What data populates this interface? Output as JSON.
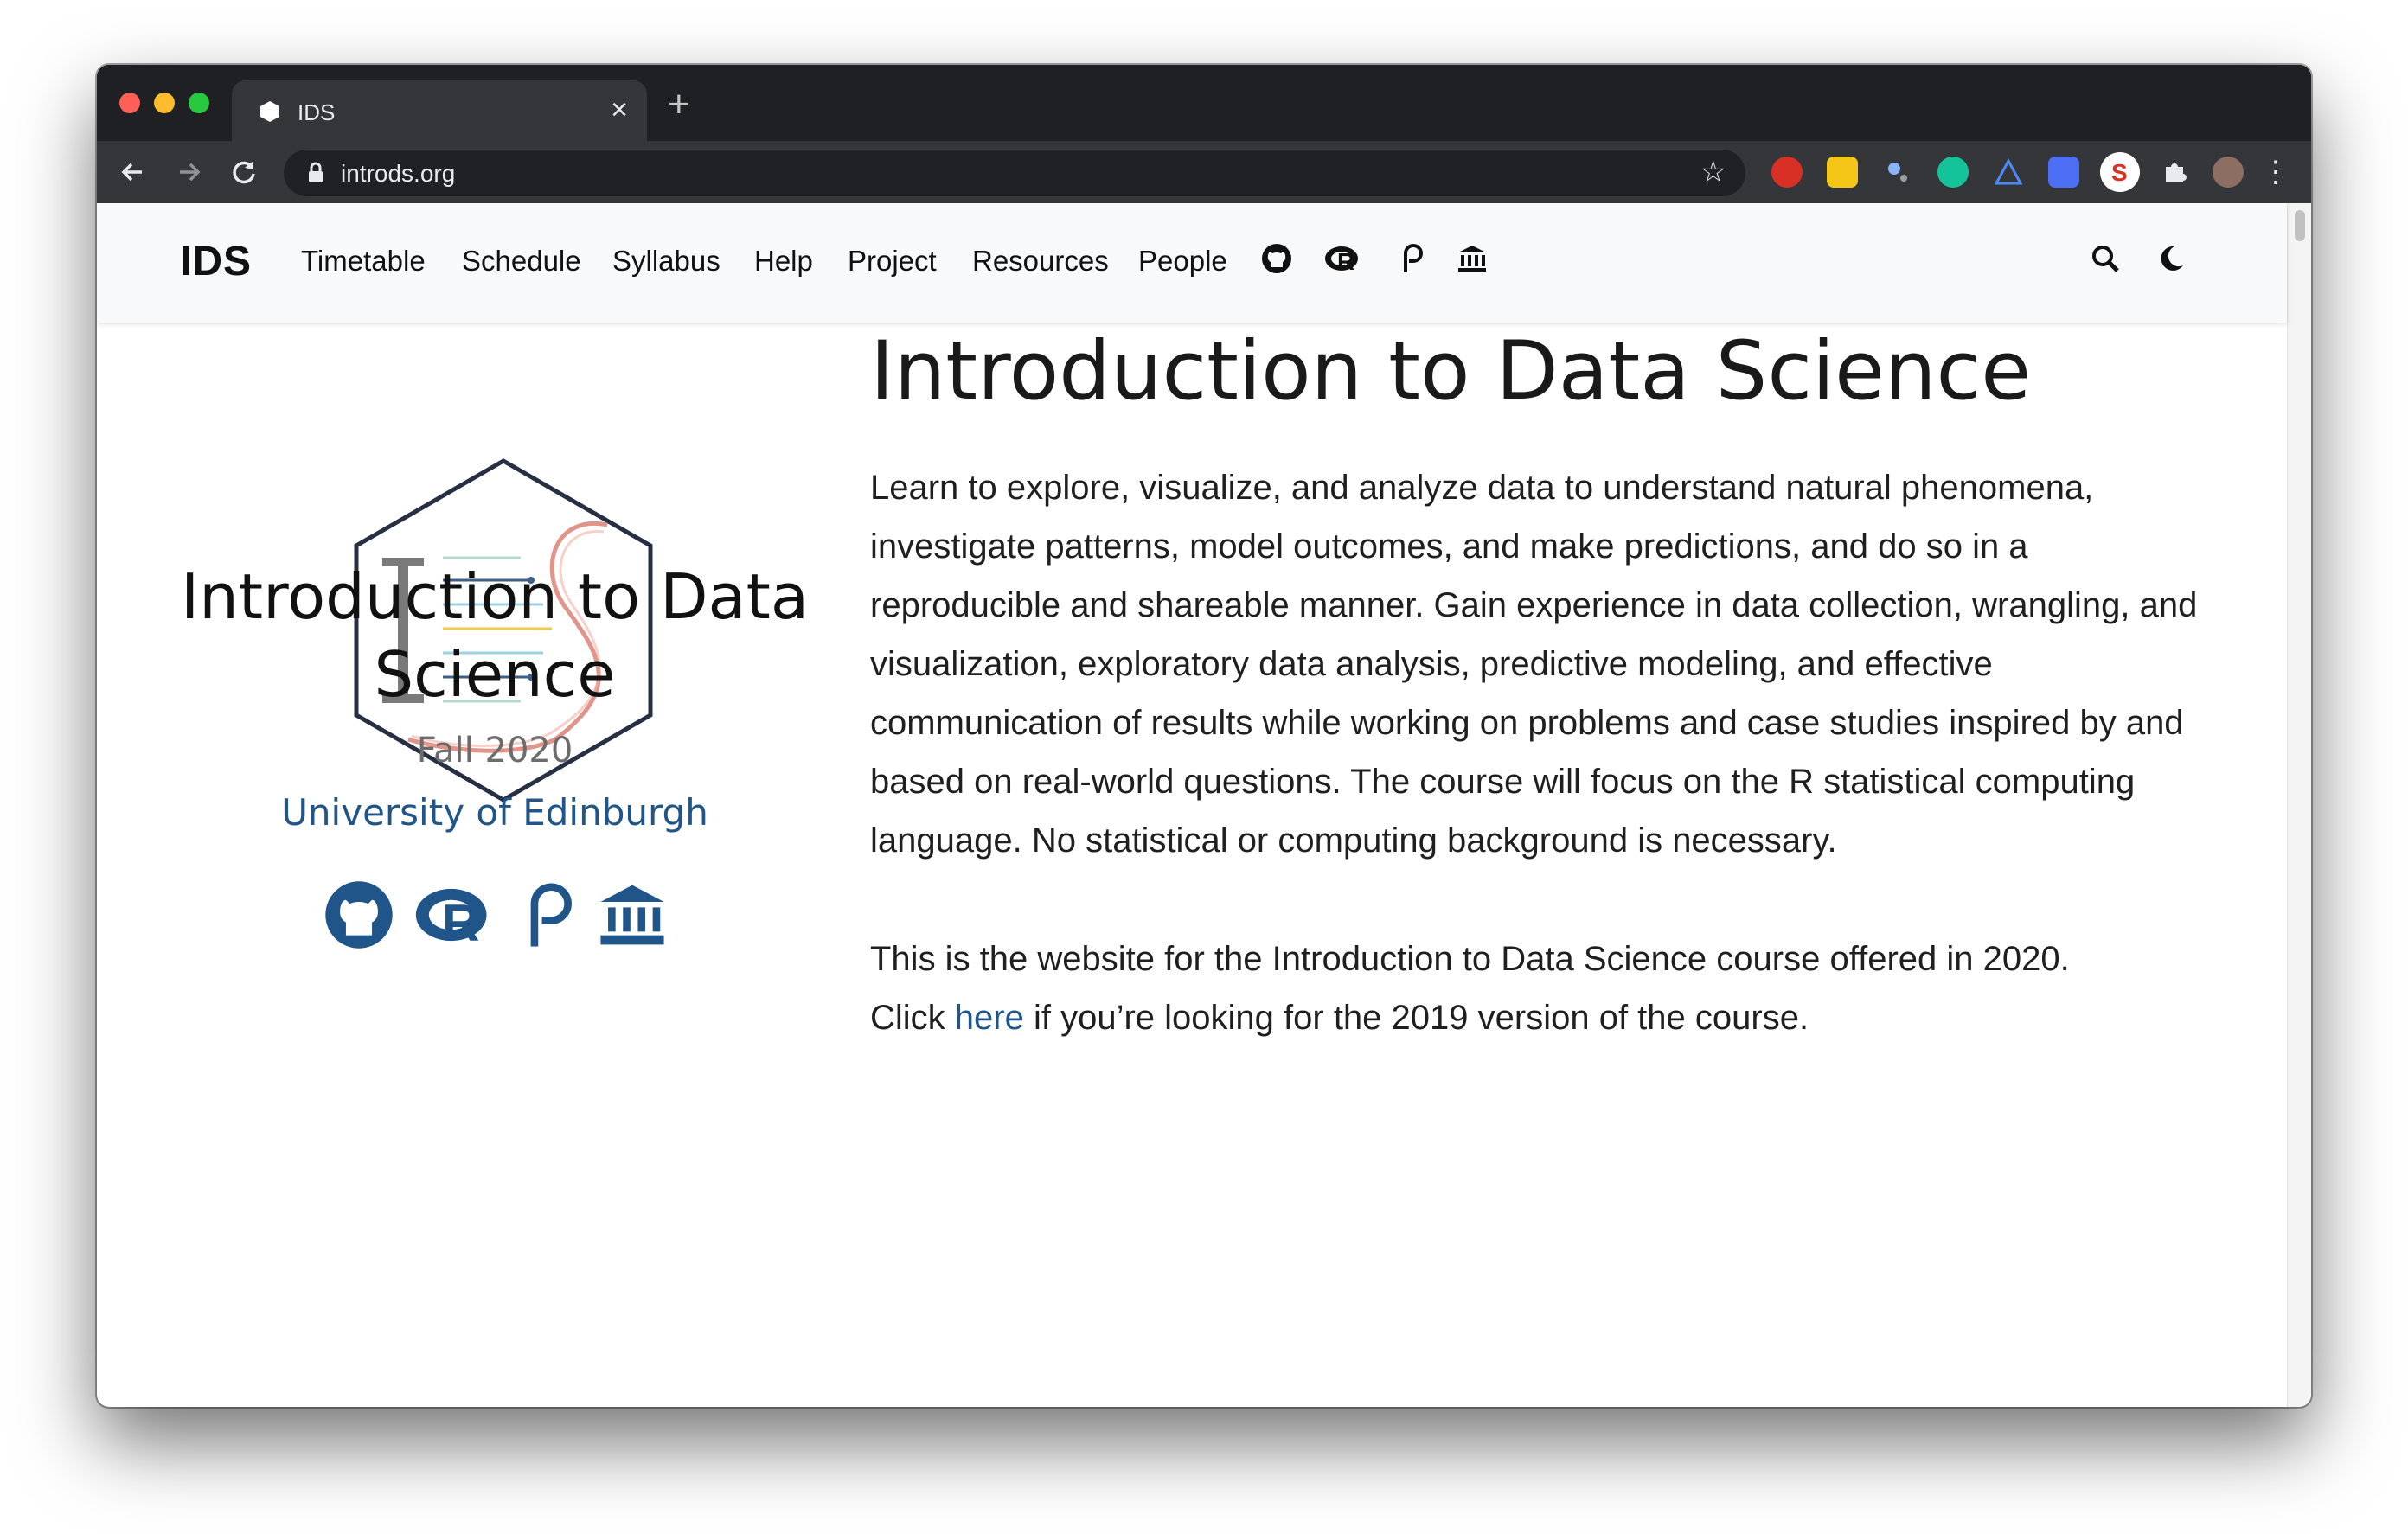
{
  "browser": {
    "tab_title": "IDS",
    "url": "introds.org",
    "new_tab_symbol": "+",
    "close_symbol": "×",
    "extensions": [
      "stop-hand-icon",
      "note-icon",
      "satellite-icon",
      "grammarly-icon",
      "triangle-icon",
      "document-icon",
      "s-extension-icon",
      "puzzle-icon",
      "profile-avatar"
    ]
  },
  "site_nav": {
    "brand": "IDS",
    "links": [
      "Timetable",
      "Schedule",
      "Syllabus",
      "Help",
      "Project",
      "Resources",
      "People"
    ],
    "icons": [
      "github-icon",
      "rstudio-cloud-icon",
      "piazza-icon",
      "university-icon"
    ],
    "right_icons": [
      "search-icon",
      "moon-icon"
    ]
  },
  "sidebar": {
    "title": "Introduction to Data Science",
    "term": "Fall 2020",
    "institution": "University of Edinburgh",
    "icons": [
      "github-icon",
      "rstudio-cloud-icon",
      "piazza-icon",
      "university-icon"
    ]
  },
  "main": {
    "title": "Introduction to Data Science",
    "description": "Learn to explore, visualize, and analyze data to understand natural phenomena, investigate patterns, model outcomes, and make predictions, and do so in a reproducible and shareable manner. Gain experience in data collection, wrangling, and visualization, exploratory data analysis, predictive modeling, and effective communication of results while working on problems and case studies inspired by and based on real-world questions. The course will focus on the R statistical computing language. No statistical or computing background is necessary.",
    "note_line1": "This is the website for the Introduction to Data Science course offered in 2020.",
    "note_click": "Click",
    "note_link": "here",
    "note_rest": "if you’re looking for the 2019 version of the course."
  },
  "colors": {
    "link_blue": "#20558a",
    "nav_bg": "#f8f9fa",
    "chrome_dark": "#1f2023"
  }
}
